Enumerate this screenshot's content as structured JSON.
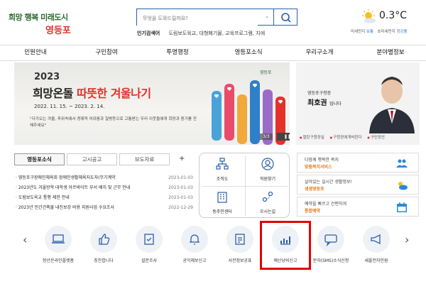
{
  "header": {
    "logo_line1": "희망 행복 미래도시",
    "logo_line2": "영등포",
    "search_placeholder": "무엇을 도와드릴까요?",
    "popular_label": "인기검색어",
    "popular_keywords": "도림보도육교, 대형폐기물, 교육프로그램, 지에",
    "weather": {
      "temp": "0.3°C",
      "fine_dust_label": "미세먼지",
      "fine_dust_value": "보통",
      "ultra_dust_label": "초미세먼지",
      "ultra_dust_value": "정강풍"
    }
  },
  "nav": [
    "민원안내",
    "구민참여",
    "투명행정",
    "영등포소식",
    "우리구소개",
    "분야별정보"
  ],
  "banner": {
    "year": "2023",
    "title_part1": "희망온돌",
    "title_part2": "따뜻한 겨울나기",
    "period": "2022. 11. 15. ~ 2023. 2. 14.",
    "desc": "\"다가오는 겨울, 추위속에서 경제적 어려움과 질병등으로 고통받는 우리 이웃들에게 희망과 용기를 전해주세요\"",
    "pager": "3/3",
    "controls": "❚❚"
  },
  "mayor": {
    "role": "영등포구청장",
    "name": "최호권",
    "name_suffix": "입니다",
    "links": [
      "열린구청장실",
      "구청장에게바란다",
      "구민장안"
    ]
  },
  "news_tabs": [
    "영등포소식",
    "고시공고",
    "보도자료"
  ],
  "news_plus": "+",
  "news": [
    {
      "title": "영등포구장애인체육회 장애인생활체육지도자(무기계약",
      "date": "2023-01-03"
    },
    {
      "title": "2023년도 겨울방학 대학생 아르바이트 부서 배치 및 근무 안내",
      "date": "2023-01-03"
    },
    {
      "title": "도림보도육교 통행 제한 안내",
      "date": "2023-01-03"
    },
    {
      "title": "2023년 민간건축물 내진보강 비용 지원사업 수요조사",
      "date": "2022-12-29"
    }
  ],
  "quick": [
    "조직도",
    "직원찾기",
    "동주민센터",
    "오시는길"
  ],
  "info_boxes": [
    {
      "a": "다함께 행복한 복지",
      "b": "맞춤복지서비스"
    },
    {
      "a": "살아있는 실시간 생활정보!",
      "b": "생생영등포"
    },
    {
      "a": "예약을 빠르고 간편하게",
      "b": "통합예약"
    }
  ],
  "services": [
    "청년온라인플랫폼",
    "칭찬합니다",
    "설문조사",
    "공익제보신고",
    "사전정보공표",
    "예산낭비신고",
    "문자(SMS)소식신청",
    "새올전자민원"
  ],
  "arrows": {
    "prev": "‹",
    "next": "›"
  }
}
